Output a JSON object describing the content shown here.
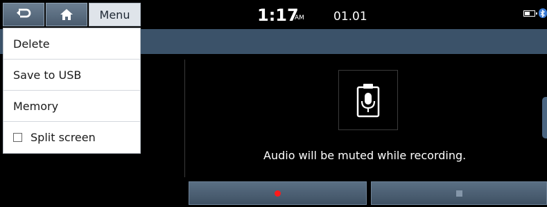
{
  "topbar": {
    "back_icon": "back-arrow-icon",
    "home_icon": "home-icon",
    "menu_label": "Menu",
    "time": "1:17",
    "ampm": "AM",
    "date": "01.01",
    "battery_icon": "battery-icon",
    "bluetooth_icon": "bluetooth-icon"
  },
  "menu": {
    "items": [
      {
        "label": "Delete"
      },
      {
        "label": "Save to USB"
      },
      {
        "label": "Memory"
      },
      {
        "label": "Split screen",
        "checked": false
      }
    ]
  },
  "recorder": {
    "icon": "voice-memo-microphone-icon",
    "message": "Audio will be muted while recording."
  },
  "controls": {
    "record_icon": "record-dot-icon",
    "stop_icon": "stop-square-icon",
    "record_color": "#ff1a1a"
  },
  "colors": {
    "header_band": "#3b5269",
    "button_blue": "#4a5c6f",
    "menu_button_bg": "#dfe4ea"
  }
}
